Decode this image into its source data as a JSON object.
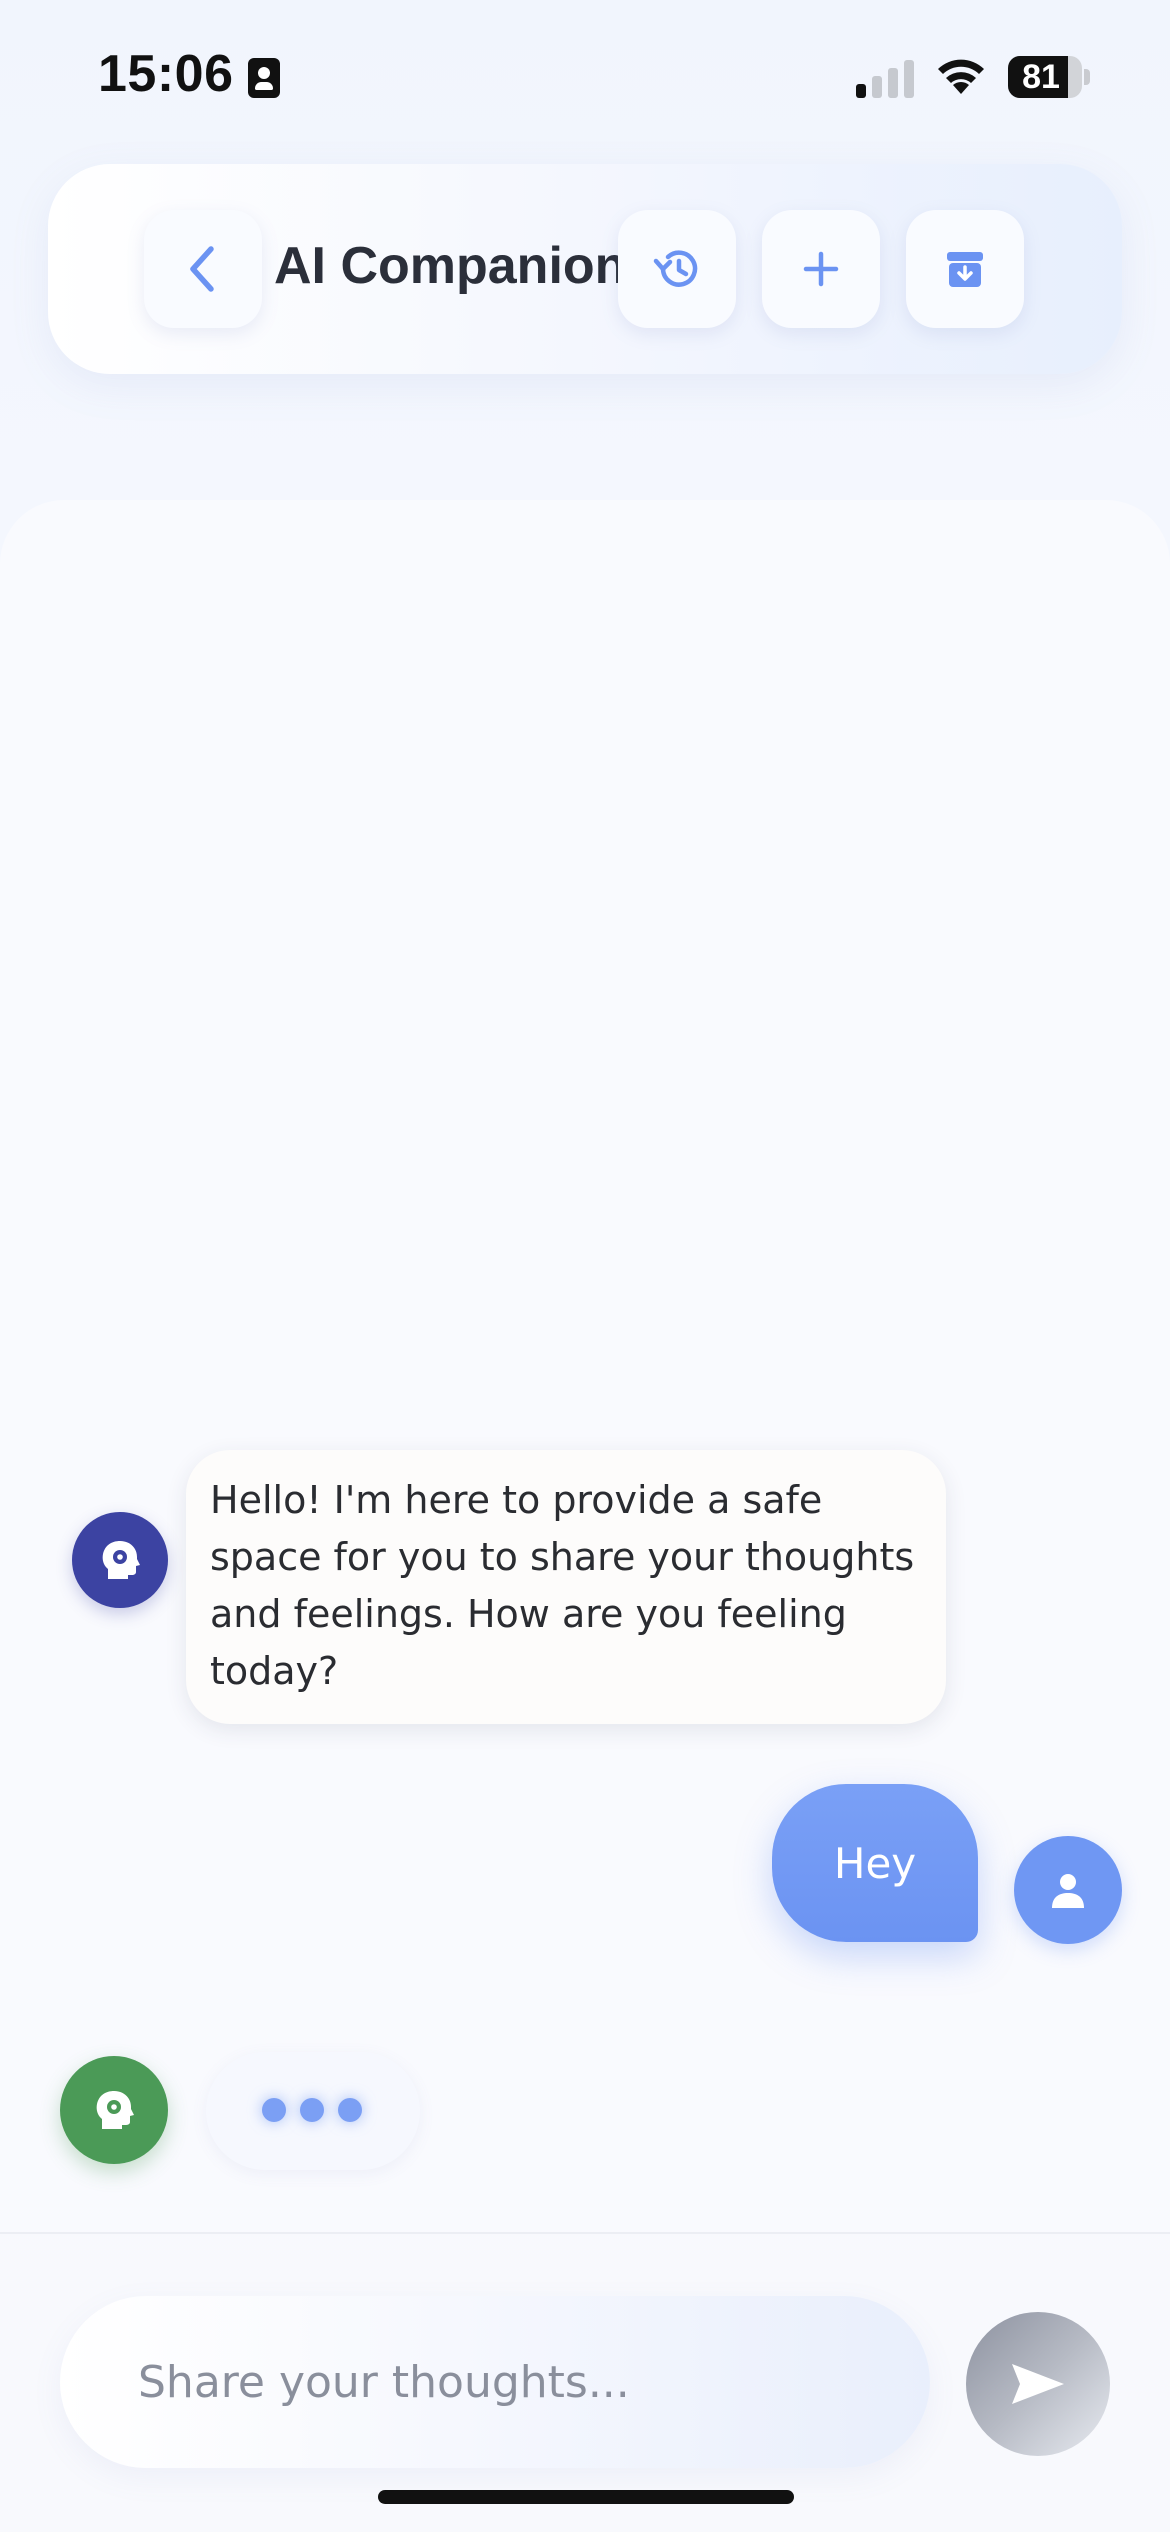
{
  "status_bar": {
    "time": "15:06",
    "battery_level": "81",
    "battery_fraction": 0.81,
    "signal_bars_active": 1,
    "signal_bars_total": 4
  },
  "header": {
    "title": "AI Companion",
    "icons": {
      "back": "chevron-left-icon",
      "history": "history-icon",
      "new_chat": "plus-icon",
      "archive": "archive-download-icon"
    }
  },
  "messages": [
    {
      "sender": "ai",
      "avatar_icon": "head-gear-icon",
      "lines": [
        "Hello! I'm here to provide a safe",
        "space for you to share your thoughts",
        "and feelings. How are you feeling",
        "today?"
      ]
    },
    {
      "sender": "user",
      "avatar_icon": "person-icon",
      "text": "Hey"
    }
  ],
  "typing_indicator": {
    "avatar_icon": "head-gear-icon",
    "dots": 3
  },
  "composer": {
    "placeholder": "Share your thoughts...",
    "value": "",
    "send_icon": "send-icon"
  },
  "colors": {
    "accent": "#6b93f2",
    "ai_avatar": "#3c43a2",
    "typing_avatar": "#4b9a57",
    "header_icon": "#6b93f2"
  }
}
